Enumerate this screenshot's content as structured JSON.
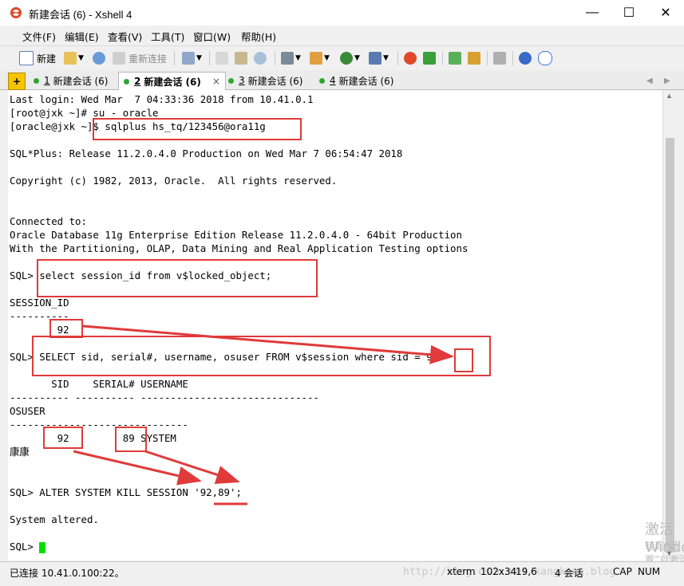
{
  "window": {
    "title": "新建会话 (6) - Xshell 4"
  },
  "menu": [
    "文件(F)",
    "编辑(E)",
    "查看(V)",
    "工具(T)",
    "窗口(W)",
    "帮助(H)"
  ],
  "toolbar": {
    "new_label": "新建",
    "reconnect_label": "重新连接"
  },
  "tabs": [
    {
      "num": "1",
      "label": "新建会话 (6)"
    },
    {
      "num": "2",
      "label": "新建会话 (6)"
    },
    {
      "num": "3",
      "label": "新建会话 (6)"
    },
    {
      "num": "4",
      "label": "新建会话 (6)"
    }
  ],
  "active_tab_close": "×",
  "terminal": {
    "lines": [
      "Last login: Wed Mar  7 04:33:36 2018 from 10.41.0.1",
      "[root@jxk ~]# su - oracle",
      "[oracle@jxk ~]$ sqlplus hs_tq/123456@ora11g",
      "",
      "SQL*Plus: Release 11.2.0.4.0 Production on Wed Mar 7 06:54:47 2018",
      "",
      "Copyright (c) 1982, 2013, Oracle.  All rights reserved.",
      "",
      "",
      "Connected to:",
      "Oracle Database 11g Enterprise Edition Release 11.2.0.4.0 - 64bit Production",
      "With the Partitioning, OLAP, Data Mining and Real Application Testing options",
      "",
      "SQL> select session_id from v$locked_object;",
      "",
      "SESSION_ID",
      "----------",
      "        92",
      "",
      "SQL> SELECT sid, serial#, username, osuser FROM v$session where sid = 92",
      "",
      "       SID    SERIAL# USERNAME",
      "---------- ---------- ------------------------------",
      "OSUSER",
      "------------------------------",
      "        92         89 SYSTEM",
      "康康",
      "",
      "",
      "SQL> ALTER SYSTEM KILL SESSION '92,89';",
      "",
      "System altered.",
      "",
      "SQL> "
    ]
  },
  "status": {
    "connection": "已连接 10.41.0.100:22。",
    "watermark_url": "http://blog.csdn.net/kangkang.blog",
    "term_type": "xterm",
    "size": "102x34",
    "cursor_pos": "19,6",
    "sessions": "4 会话",
    "cap": "CAP",
    "num": "NUM"
  },
  "watermark": {
    "line1": "激活 Windows",
    "line2": "转到“设置”以激活 Windows。"
  },
  "colors": {
    "highlight": "#e03a3a",
    "cursor": "#00e000"
  }
}
